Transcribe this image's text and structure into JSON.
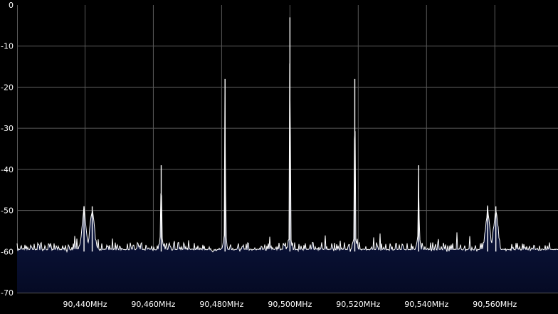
{
  "spectrum": {
    "colors": {
      "background": "#000000",
      "grid": "#5a5a5a",
      "trace": "#ffffff",
      "fill_top": "#1a2d74",
      "fill_bottom": "#050a24",
      "label": "#ffffff"
    },
    "y_axis": {
      "ticks": [
        "0",
        "-10",
        "-20",
        "-30",
        "-40",
        "-50",
        "-60",
        "-70"
      ]
    },
    "x_axis": {
      "ticks": [
        "90,440MHz",
        "90,460MHz",
        "90,480MHz",
        "90,500MHz",
        "90,520MHz",
        "90,540MHz",
        "90,560MHz"
      ]
    }
  },
  "chart_data": {
    "type": "area",
    "title": "",
    "xlabel": "",
    "ylabel": "",
    "x_unit": "MHz",
    "xlim": [
      90.4201,
      90.5785
    ],
    "ylim": [
      -70,
      0
    ],
    "grid": true,
    "noise_floor": -60,
    "peaks": [
      {
        "x": 90.4397,
        "y": -49
      },
      {
        "x": 90.4421,
        "y": -49
      },
      {
        "x": 90.4623,
        "y": -39
      },
      {
        "x": 90.481,
        "y": -18
      },
      {
        "x": 90.5,
        "y": -3
      },
      {
        "x": 90.519,
        "y": -18
      },
      {
        "x": 90.5377,
        "y": -39
      },
      {
        "x": 90.5579,
        "y": -49
      },
      {
        "x": 90.5603,
        "y": -49
      }
    ]
  }
}
